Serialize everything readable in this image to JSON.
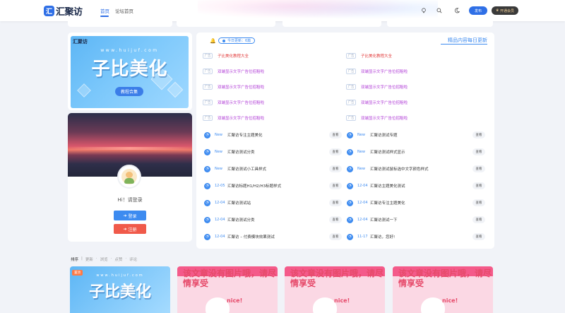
{
  "brand": {
    "name": "汇聚访",
    "mark": "汇"
  },
  "nav": {
    "home": "首页",
    "forum": "论坛首页"
  },
  "toolbar": {
    "post_label": "发布",
    "vip_label": "开通会员",
    "icons": [
      "bulb-icon",
      "search-icon",
      "moon-icon"
    ]
  },
  "colors": {
    "accent": "#2f6fe6",
    "ad_red": "#e23b3b",
    "ad_purple": "#b03cd6"
  },
  "banner": {
    "logo": "汇聚访",
    "url": "www.huijuf.com",
    "title": "子比美化",
    "subtitle": "教程合集"
  },
  "user": {
    "greeting": "Hi！请登录",
    "login_label": "登录",
    "register_label": "注册"
  },
  "updates": {
    "today_label": "今日更新：6篇",
    "daily_label": "精品内容每日更新",
    "ad_tag": "广告",
    "ads_left": [
      {
        "text": "子比美化教程大全",
        "color": "#e23b3b"
      },
      {
        "text": "双端显示文字广告位招租啦",
        "color": "#b03cd6"
      },
      {
        "text": "双端显示文字广告位招租啦",
        "color": "#b03cd6"
      },
      {
        "text": "双端显示文字广告位招租啦",
        "color": "#b03cd6"
      },
      {
        "text": "双端显示文字广告位招租啦",
        "color": "#b03cd6"
      }
    ],
    "ads_right": [
      {
        "text": "子比美化教程大全",
        "color": "#e23b3b"
      },
      {
        "text": "双端显示文字广告位招租啦",
        "color": "#b03cd6"
      },
      {
        "text": "双端显示文字广告位招租啦",
        "color": "#b03cd6"
      },
      {
        "text": "双端显示文字广告位招租啦",
        "color": "#b03cd6"
      },
      {
        "text": "双端显示文字广告位招租啦",
        "color": "#b03cd6"
      }
    ],
    "view_label": "查看",
    "items_left": [
      {
        "date": "New",
        "title": "汇聚访专注主题美化"
      },
      {
        "date": "New",
        "title": "汇聚访测试分类"
      },
      {
        "date": "New",
        "title": "汇聚访测试小工具样式"
      },
      {
        "date": "12-05",
        "title": "汇聚访标题H1/H2/H3标题样式"
      },
      {
        "date": "12-04",
        "title": "汇聚访测试站"
      },
      {
        "date": "12-04",
        "title": "汇聚访测试分类"
      },
      {
        "date": "12-04",
        "title": "汇聚访 – 付费模块效果测试"
      }
    ],
    "items_right": [
      {
        "date": "New",
        "title": "汇聚访测试专题"
      },
      {
        "date": "New",
        "title": "汇聚访测试样式显示"
      },
      {
        "date": "New",
        "title": "汇聚访测试鼠标选中文字颜色样式"
      },
      {
        "date": "12-04",
        "title": "汇聚访主题美化测试"
      },
      {
        "date": "12-04",
        "title": "汇聚访专注主题美化"
      },
      {
        "date": "12-04",
        "title": "汇聚访测试一下"
      },
      {
        "date": "11-17",
        "title": "汇聚访，您好!"
      }
    ]
  },
  "sort": {
    "label": "排序",
    "options": [
      "更新",
      "浏览",
      "点赞",
      "评论"
    ]
  },
  "posts": [
    {
      "badge": "置顶",
      "url": "www.huijuf.com",
      "title": "子比美化"
    },
    {
      "text": "该文章没有图片哦，请尽情享受",
      "nice": "nice!"
    },
    {
      "text": "该文章没有图片哦，请尽情享受",
      "nice": "nice!"
    },
    {
      "text": "该文章没有图片哦，请尽情享受",
      "nice": "nice!"
    }
  ]
}
